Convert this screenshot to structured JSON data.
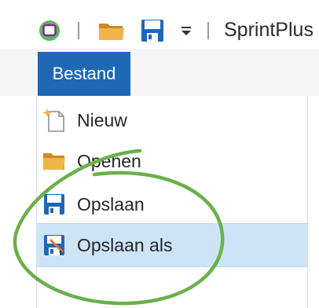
{
  "window": {
    "title": "SprintPlus"
  },
  "quick_access_toolbar": {
    "icons": [
      "app-icon",
      "folder-open-icon",
      "save-icon",
      "customize-dropdown-icon"
    ]
  },
  "ribbon": {
    "tabs": [
      {
        "label": "Bestand",
        "selected": true
      }
    ]
  },
  "file_menu": {
    "items": [
      {
        "label": "Nieuw",
        "icon": "new-document-icon",
        "highlighted": false
      },
      {
        "label": "Openen",
        "icon": "folder-open-icon",
        "highlighted": false
      },
      {
        "label": "Opslaan",
        "icon": "save-icon",
        "highlighted": false
      },
      {
        "label": "Opslaan als",
        "icon": "save-as-icon",
        "highlighted": true
      }
    ]
  },
  "colors": {
    "accent": "#1e68b5",
    "highlight": "#cde4f7",
    "annotation_green": "#6ab04c",
    "app_icon_green": "#5cb85c",
    "app_icon_purple": "#7b2d8e",
    "folder": "#e8a93a"
  }
}
